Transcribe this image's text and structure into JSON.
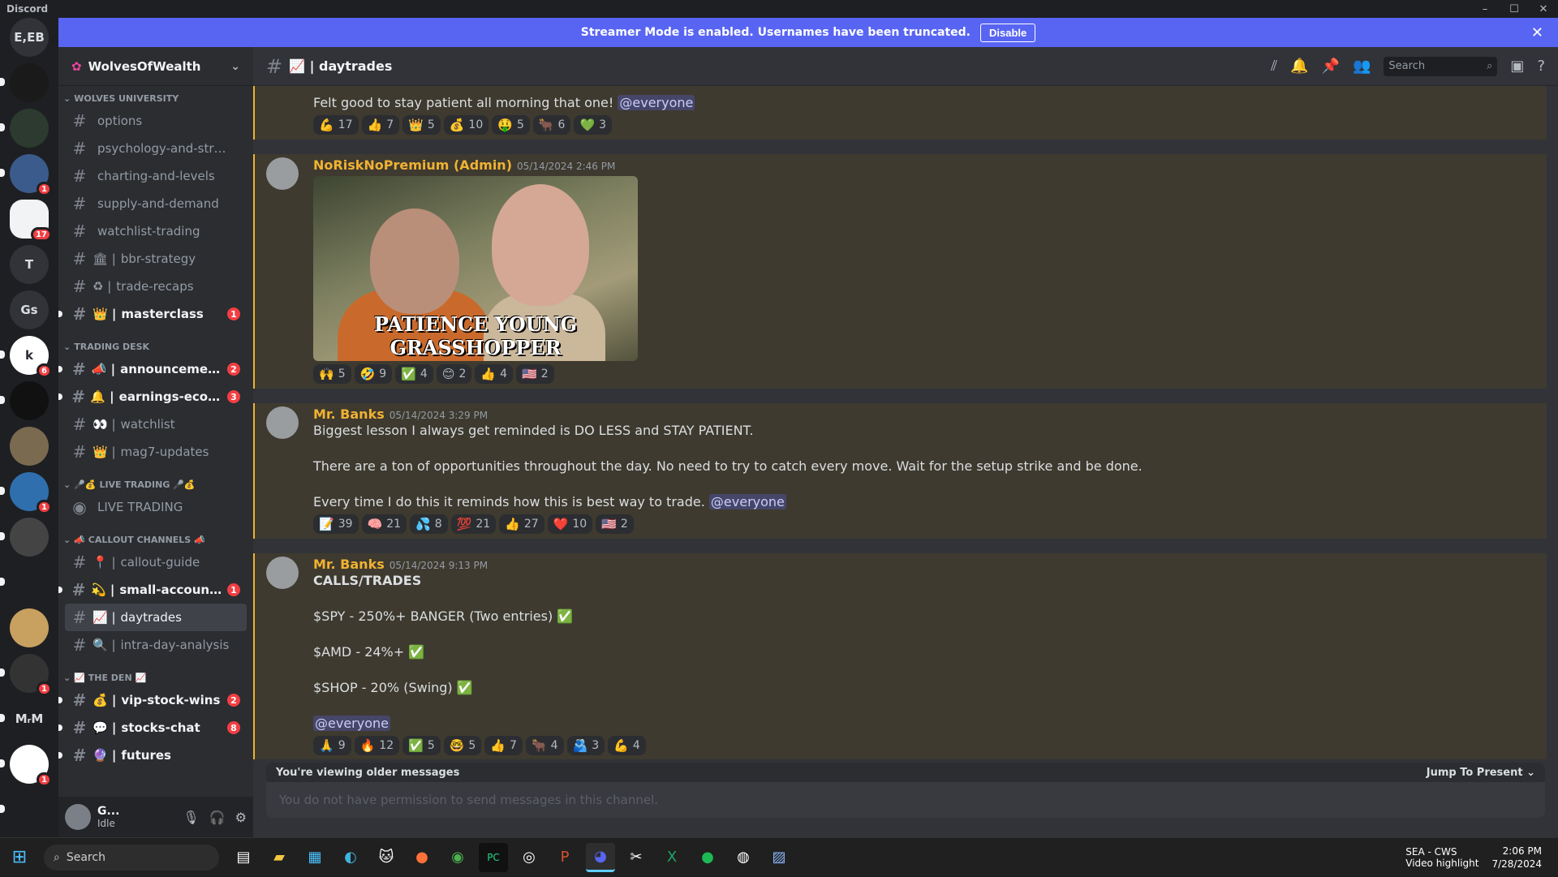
{
  "window": {
    "app_name": "Discord",
    "controls": [
      "–",
      "☐",
      "✕"
    ]
  },
  "rail": {
    "servers": [
      {
        "label": "E,EB",
        "badge": "",
        "unread": false
      },
      {
        "label": "",
        "badge": "",
        "unread": true
      },
      {
        "label": "",
        "badge": "",
        "unread": true
      },
      {
        "label": "",
        "badge": "1",
        "unread": true
      },
      {
        "label": "",
        "badge": "17",
        "unread": false,
        "selected": true
      },
      {
        "label": "T",
        "badge": "",
        "unread": false
      },
      {
        "label": "Gs",
        "badge": "",
        "unread": false
      },
      {
        "label": "k",
        "badge": "6",
        "unread": true
      },
      {
        "label": "",
        "badge": "",
        "unread": true
      },
      {
        "label": "",
        "badge": "",
        "unread": false
      },
      {
        "label": "",
        "badge": "1",
        "unread": true
      },
      {
        "label": "",
        "badge": "",
        "unread": true
      },
      {
        "label": "",
        "badge": "",
        "unread": true
      },
      {
        "label": "",
        "badge": "",
        "unread": false
      },
      {
        "label": "",
        "badge": "1",
        "unread": true
      },
      {
        "label": "MᵣM",
        "badge": "",
        "unread": true
      },
      {
        "label": "",
        "badge": "1",
        "unread": true
      },
      {
        "label": "",
        "badge": "",
        "unread": true
      }
    ]
  },
  "banner": {
    "text": "Streamer Mode is enabled. Usernames have been truncated.",
    "button": "Disable",
    "close": "✕"
  },
  "guild": {
    "name": "WolvesOfWealth",
    "chevron": "⌄"
  },
  "categories": [
    {
      "name": "WOLVES UNIVERSITY",
      "channels": [
        {
          "icon": "",
          "name": "options",
          "unread": false,
          "count": ""
        },
        {
          "icon": "",
          "name": "psychology-and-strategi...",
          "unread": false,
          "count": ""
        },
        {
          "icon": "",
          "name": "charting-and-levels",
          "unread": false,
          "count": ""
        },
        {
          "icon": "",
          "name": "supply-and-demand",
          "unread": false,
          "count": ""
        },
        {
          "icon": "",
          "name": "watchlist-trading",
          "unread": false,
          "count": ""
        },
        {
          "icon": "🏛 |",
          "name": "bbr-strategy",
          "unread": false,
          "count": ""
        },
        {
          "icon": "♻ |",
          "name": "trade-recaps",
          "unread": false,
          "count": ""
        },
        {
          "icon": "👑 |",
          "name": "masterclass",
          "unread": true,
          "count": "1"
        }
      ]
    },
    {
      "name": "TRADING DESK",
      "channels": [
        {
          "icon": "📣 |",
          "name": "announcements",
          "unread": true,
          "count": "2"
        },
        {
          "icon": "🔔 |",
          "name": "earnings-econo...",
          "unread": true,
          "count": "3"
        },
        {
          "icon": "👀 |",
          "name": "watchlist",
          "unread": false,
          "count": ""
        },
        {
          "icon": "👑 |",
          "name": "mag7-updates",
          "unread": false,
          "count": ""
        }
      ]
    },
    {
      "name": "🎤💰 LIVE TRADING 🎤💰",
      "channels": [
        {
          "icon": "",
          "name": "LIVE TRADING",
          "unread": false,
          "count": "",
          "voice": true
        }
      ]
    },
    {
      "name": "📣 CALLOUT CHANNELS 📣",
      "channels": [
        {
          "icon": "📍 |",
          "name": "callout-guide",
          "unread": false,
          "count": ""
        },
        {
          "icon": "💫 |",
          "name": "small-account-...",
          "unread": true,
          "count": "1"
        },
        {
          "icon": "📈 |",
          "name": "daytrades",
          "unread": false,
          "count": "",
          "selected": true
        },
        {
          "icon": "🔍 |",
          "name": "intra-day-analysis",
          "unread": false,
          "count": ""
        }
      ]
    },
    {
      "name": "📈 THE DEN 📈",
      "channels": [
        {
          "icon": "💰 |",
          "name": "vip-stock-wins",
          "unread": true,
          "count": "2"
        },
        {
          "icon": "💬 |",
          "name": "stocks-chat",
          "unread": true,
          "count": "8"
        },
        {
          "icon": "🔮 |",
          "name": "futures",
          "unread": true,
          "count": ""
        }
      ]
    }
  ],
  "user": {
    "name": "G...",
    "status": "Idle"
  },
  "channel_header": {
    "title": "📈 | daytrades",
    "search_placeholder": "Search"
  },
  "messages": [
    {
      "author": "",
      "timestamp": "",
      "lines": [
        {
          "text": "Felt good to stay patient all morning that one! ",
          "mention": "@everyone"
        }
      ],
      "reactions": [
        [
          "💪",
          "17"
        ],
        [
          "👍",
          "7"
        ],
        [
          "👑",
          "5"
        ],
        [
          "💰",
          "10"
        ],
        [
          "🤑",
          "5"
        ],
        [
          "🐂",
          "6"
        ],
        [
          "💚",
          "3"
        ]
      ]
    },
    {
      "author": "NoRiskNoPremium (Admin)",
      "timestamp": "05/14/2024 2:46 PM",
      "gif_caption": "PATIENCE YOUNG GRASSHOPPER",
      "lines": [],
      "reactions": [
        [
          "🙌",
          "5"
        ],
        [
          "🤣",
          "9"
        ],
        [
          "✅",
          "4"
        ],
        [
          "😊",
          "2"
        ],
        [
          "👍",
          "4"
        ],
        [
          "🇺🇸",
          "2"
        ]
      ]
    },
    {
      "author": "Mr. Banks",
      "timestamp": "05/14/2024 3:29 PM",
      "lines": [
        {
          "text": "Biggest lesson I always get reminded is DO LESS and STAY PATIENT.",
          "mention": ""
        },
        {
          "text": "",
          "mention": ""
        },
        {
          "text": "There are a ton of opportunities throughout the day. No need to try to catch every move. Wait for the setup strike and be done.",
          "mention": ""
        },
        {
          "text": "",
          "mention": ""
        },
        {
          "text": "Every time I do this it reminds how this is best way to trade. ",
          "mention": "@everyone"
        }
      ],
      "reactions": [
        [
          "📝",
          "39"
        ],
        [
          "🧠",
          "21"
        ],
        [
          "💦",
          "8"
        ],
        [
          "💯",
          "21"
        ],
        [
          "👍",
          "27"
        ],
        [
          "❤️",
          "10"
        ],
        [
          "🇺🇸",
          "2"
        ]
      ]
    },
    {
      "author": "Mr. Banks",
      "timestamp": "05/14/2024 9:13 PM",
      "lines": [
        {
          "text": "CALLS/TRADES",
          "mention": "",
          "bold": true
        },
        {
          "text": "",
          "mention": ""
        },
        {
          "text": "$SPY - 250%+ BANGER (Two entries) ✅",
          "mention": ""
        },
        {
          "text": "",
          "mention": ""
        },
        {
          "text": "$AMD - 24%+ ✅",
          "mention": ""
        },
        {
          "text": "",
          "mention": ""
        },
        {
          "text": "$SHOP - 20% (Swing) ✅",
          "mention": ""
        },
        {
          "text": "",
          "mention": ""
        },
        {
          "text": "",
          "mention": "@everyone"
        }
      ],
      "reactions": [
        [
          "🙏",
          "9"
        ],
        [
          "🔥",
          "12"
        ],
        [
          "✅",
          "5"
        ],
        [
          "🤓",
          "5"
        ],
        [
          "👍",
          "7"
        ],
        [
          "🐂",
          "4"
        ],
        [
          "🫂",
          "3"
        ],
        [
          "💪",
          "4"
        ]
      ]
    }
  ],
  "composer": {
    "older_text": "You're viewing older messages",
    "jump_text": "Jump To Present ⌄",
    "placeholder": "You do not have permission to send messages in this channel."
  },
  "taskbar": {
    "search": "Search",
    "tray_title": "SEA - CWS",
    "tray_sub": "Video highlight",
    "time": "2:06 PM",
    "date": "7/28/2024"
  }
}
